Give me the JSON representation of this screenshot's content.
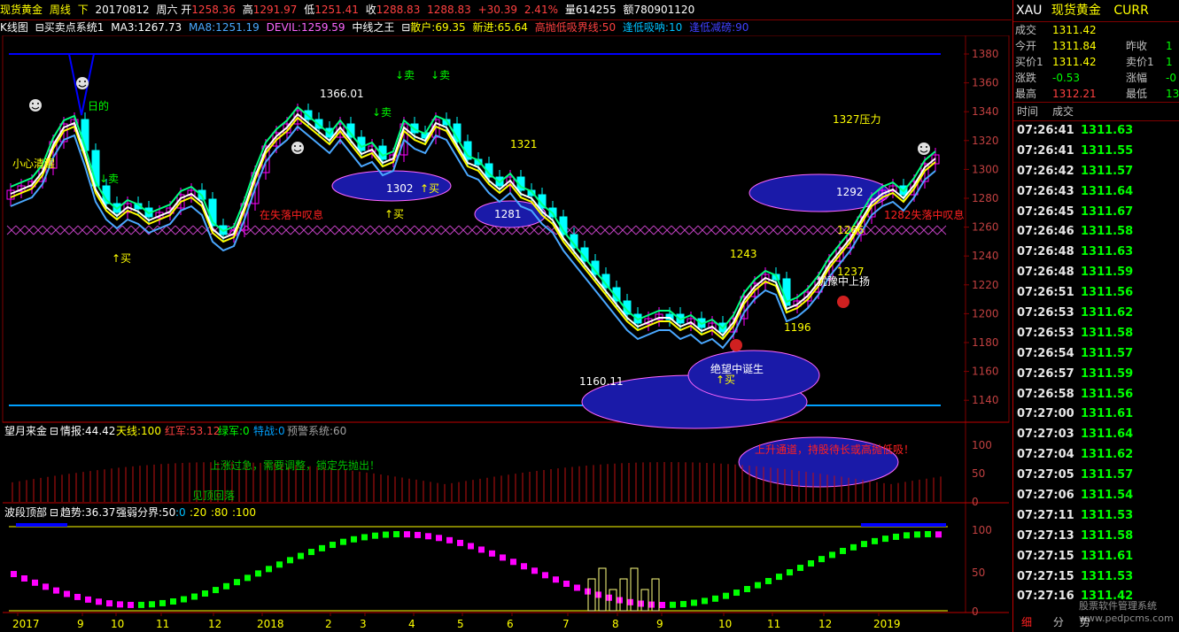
{
  "header": {
    "symbol": "现货黄金",
    "period": "周线",
    "arrow": "下",
    "date": "20170812",
    "weekday": "周六",
    "open_label": "开",
    "open": "1258.36",
    "high_label": "高",
    "high": "1291.97",
    "low_label": "低",
    "low": "1251.41",
    "close_label": "收",
    "close": "1288.83",
    "last": "1288.83",
    "change": "+30.39",
    "change_pct": "2.41%",
    "volume_label": "量",
    "volume": "614255",
    "amount_label": "额",
    "amount": "780901120"
  },
  "kline_indicators": {
    "name": "K线图",
    "system": "买卖点系统1",
    "ma3": "MA3:1267.73",
    "ma8": "MA8:1251.19",
    "devil": "DEVIL:1259.59",
    "zhong": "中线之王",
    "sanhu": "散户:69.35",
    "xinjin": "新进:65.64",
    "gaopao": "高抛低吸界线:50",
    "fengdi": "逢低吸呐:10",
    "fengdi2": "逢低减磅:90"
  },
  "main_chart": {
    "y_labels": [
      "1380",
      "1360",
      "1340",
      "1320",
      "1300",
      "1280",
      "1260",
      "1240",
      "1220",
      "1200",
      "1180",
      "1160",
      "1140"
    ],
    "annotations": {
      "a1366": "1366.01",
      "a1302": "1302",
      "buy": "↑买",
      "a1281": "1281",
      "a1321": "1321",
      "sell": "↓卖",
      "careful": "小心清醒",
      "ri": "日的",
      "a1292": "1292",
      "a1327": "1327压力",
      "a1243": "1243",
      "a1266": "1266",
      "a1237": "1237",
      "a1196": "1196",
      "a1160": "1160.11",
      "despair": "绝望中诞生",
      "hesitate": "犹豫中上扬",
      "sigh1": "在失落中叹息",
      "sigh2": "1282失落中叹息"
    }
  },
  "panel2": {
    "title": "望月来金",
    "qingbao": "情报:44.42",
    "tianxian": "天线:100",
    "hongjun": "红军:53.12",
    "lvjun": "绿军:0",
    "tezhan": "特战:0",
    "yujing": "预警系统:60",
    "y_labels": [
      "100",
      "50",
      "0"
    ],
    "text_up": "上升通道，持股待长或高抛低吸！",
    "text_mid": "上涨过急，需要调整，锁定先抛出！",
    "text_low": "见顶回落"
  },
  "panel3": {
    "title": "波段顶部",
    "trend": "趋势:36.37",
    "boundary": "强弱分界:50",
    "l0": ":0",
    "l20": ":20",
    "l80": ":80",
    "l100": ":100",
    "y_labels": [
      "100",
      "50",
      "0"
    ]
  },
  "x_axis": [
    "2017",
    "9",
    "10",
    "11",
    "12",
    "2018",
    "2",
    "3",
    "4",
    "5",
    "6",
    "7",
    "8",
    "9",
    "10",
    "11",
    "12",
    "2019"
  ],
  "quote": {
    "code": "XAU",
    "name": "现货黄金",
    "currency": "CURR",
    "rows": [
      {
        "l1": "成交",
        "v1": "1311.42",
        "l2": "",
        "v2": ""
      },
      {
        "l1": "今开",
        "v1": "1311.84",
        "l2": "昨收",
        "v2": "1"
      },
      {
        "l1": "买价1",
        "v1": "1311.42",
        "l2": "卖价1",
        "v2": "1"
      },
      {
        "l1": "涨跌",
        "v1": "-0.53",
        "l2": "涨幅",
        "v2": "-0"
      },
      {
        "l1": "最高",
        "v1": "1312.21",
        "l2": "最低",
        "v2": "13"
      }
    ]
  },
  "ticks_header": {
    "time": "时间",
    "trade": "成交"
  },
  "ticks": [
    {
      "time": "07:26:41",
      "price": "1311.63"
    },
    {
      "time": "07:26:41",
      "price": "1311.55"
    },
    {
      "time": "07:26:42",
      "price": "1311.57"
    },
    {
      "time": "07:26:43",
      "price": "1311.64"
    },
    {
      "time": "07:26:45",
      "price": "1311.67"
    },
    {
      "time": "07:26:46",
      "price": "1311.58"
    },
    {
      "time": "07:26:48",
      "price": "1311.63"
    },
    {
      "time": "07:26:48",
      "price": "1311.59"
    },
    {
      "time": "07:26:51",
      "price": "1311.56"
    },
    {
      "time": "07:26:53",
      "price": "1311.62"
    },
    {
      "time": "07:26:53",
      "price": "1311.58"
    },
    {
      "time": "07:26:54",
      "price": "1311.57"
    },
    {
      "time": "07:26:57",
      "price": "1311.59"
    },
    {
      "time": "07:26:58",
      "price": "1311.56"
    },
    {
      "time": "07:27:00",
      "price": "1311.61"
    },
    {
      "time": "07:27:03",
      "price": "1311.64"
    },
    {
      "time": "07:27:04",
      "price": "1311.62"
    },
    {
      "time": "07:27:05",
      "price": "1311.57"
    },
    {
      "time": "07:27:06",
      "price": "1311.54"
    },
    {
      "time": "07:27:11",
      "price": "1311.53"
    },
    {
      "time": "07:27:13",
      "price": "1311.58"
    },
    {
      "time": "07:27:15",
      "price": "1311.61"
    },
    {
      "time": "07:27:15",
      "price": "1311.53"
    },
    {
      "time": "07:27:16",
      "price": "1311.42"
    }
  ],
  "bottom": {
    "detail": "细",
    "x1": "分",
    "x2": "势"
  },
  "watermark": "股票软件管理系统 www.pedpcms.com",
  "colors": {
    "up": "#ff00ff",
    "down": "#00ffff",
    "ma3": "#ffff00",
    "ma8": "#00ff7f",
    "devil": "#4aa8ff",
    "ellipse": "#1a1aa8",
    "red": "#ff2020",
    "green": "#00ff00"
  }
}
